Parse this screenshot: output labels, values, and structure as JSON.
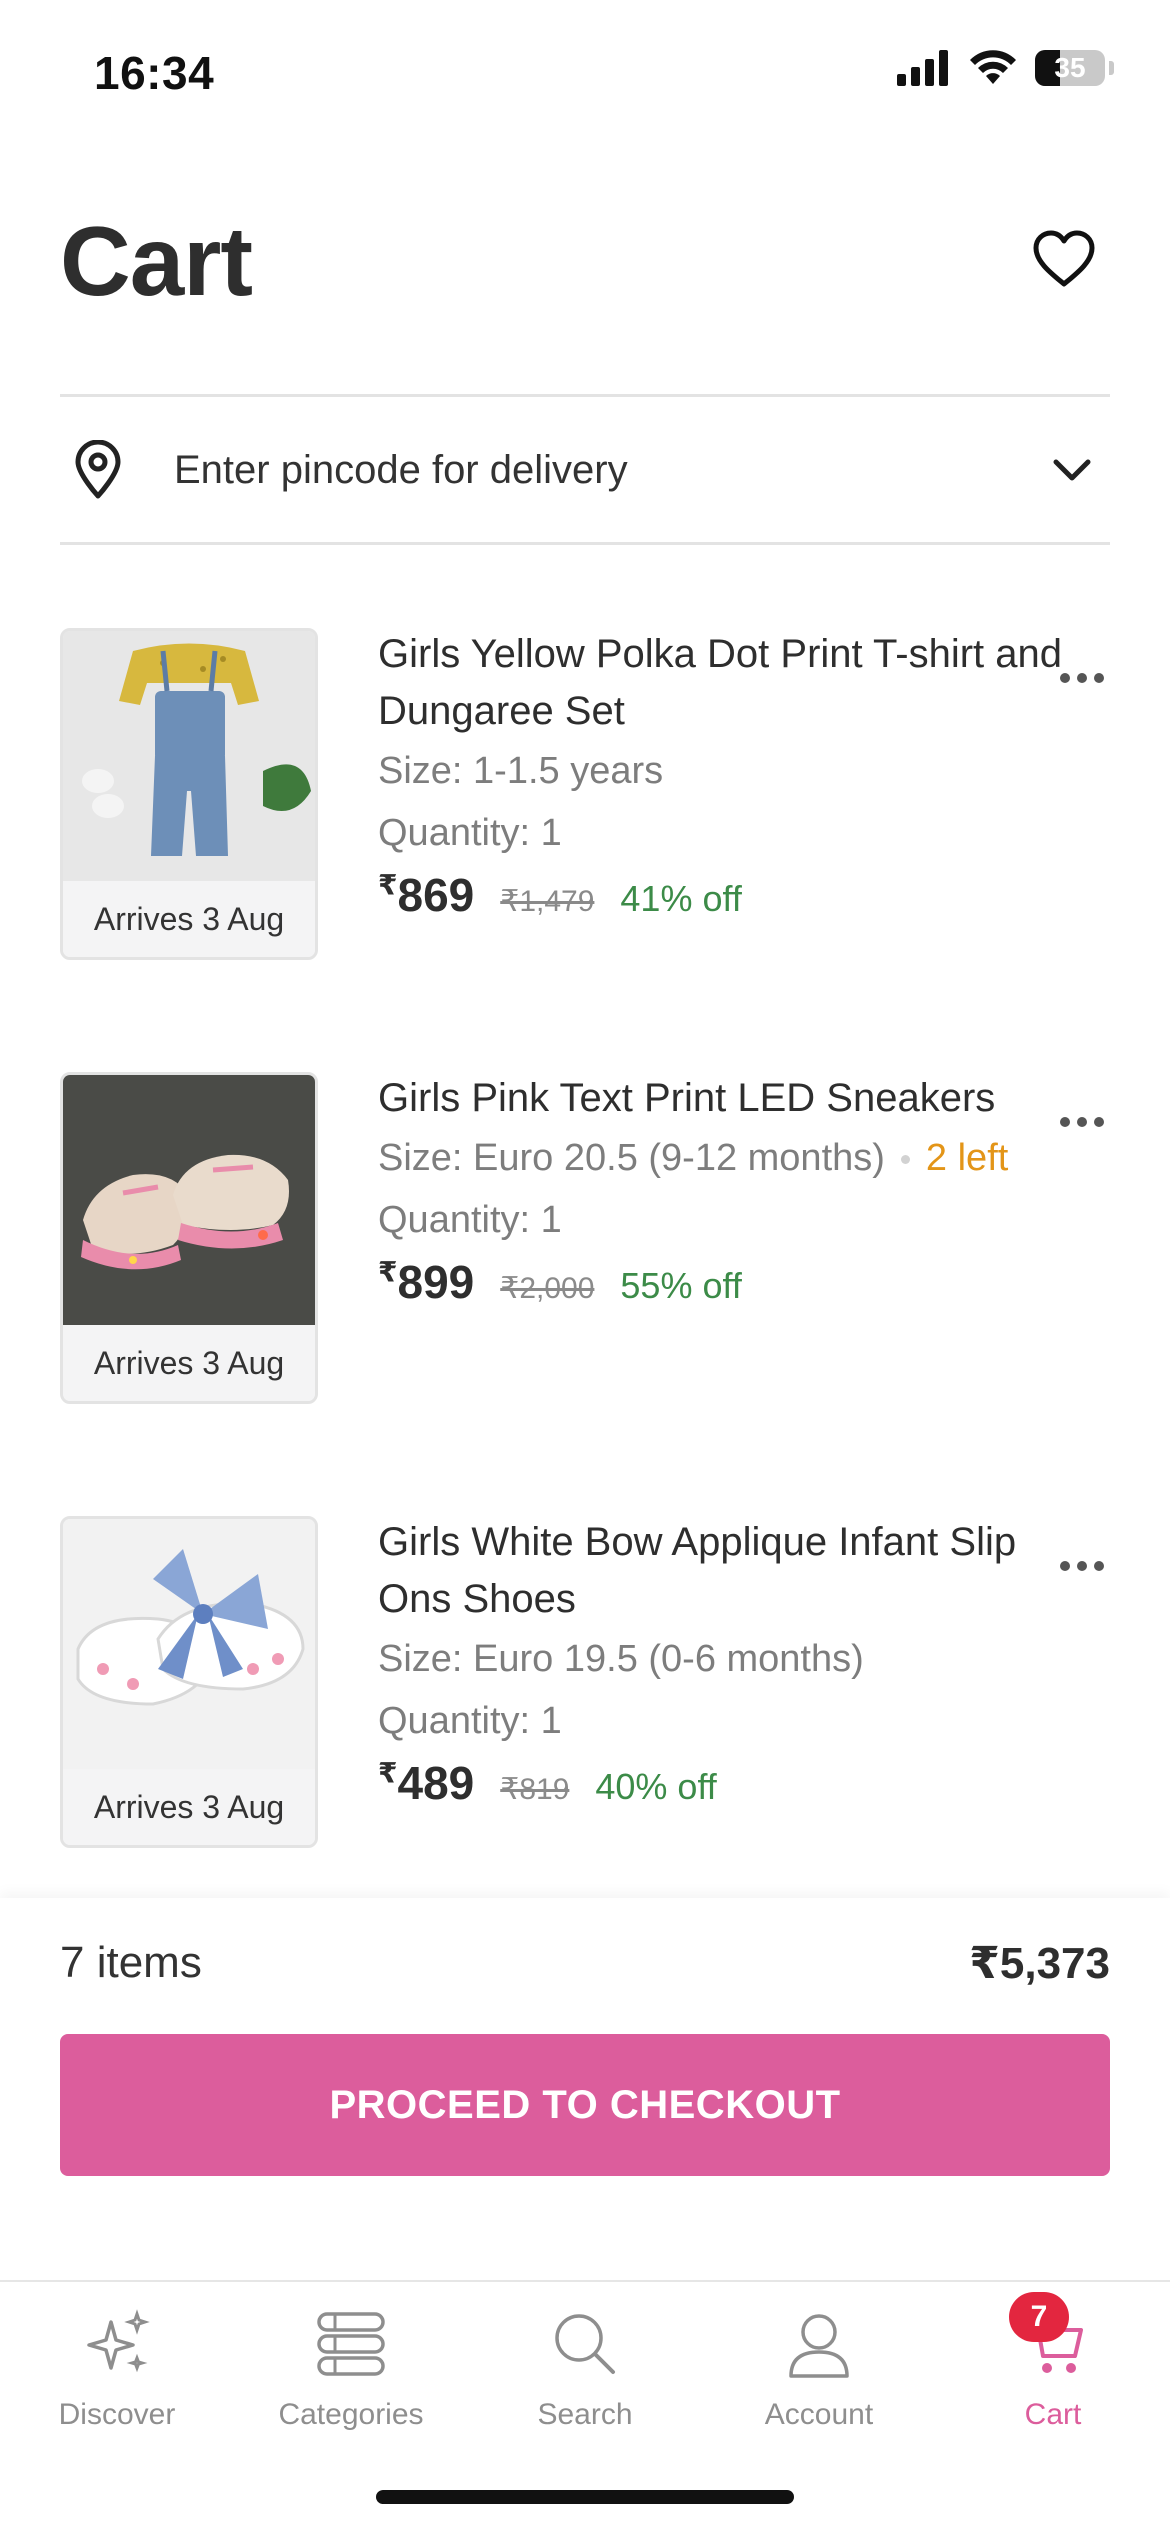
{
  "status_bar": {
    "time": "16:34",
    "battery_level": "35"
  },
  "header": {
    "title": "Cart"
  },
  "pincode": {
    "label": "Enter pincode for delivery"
  },
  "items": [
    {
      "name": "Girls Yellow Polka Dot Print T-shirt and Dungaree Set",
      "size": "Size: 1-1.5 years",
      "stock_note": "",
      "quantity": "Quantity: 1",
      "currency": "₹",
      "price": "869",
      "mrp": "₹1,479",
      "discount": "41% off",
      "arrival": "Arrives 3 Aug"
    },
    {
      "name": "Girls Pink Text Print LED Sneakers",
      "size": "Size: Euro 20.5 (9-12 months)",
      "stock_note": "2 left",
      "quantity": "Quantity: 1",
      "currency": "₹",
      "price": "899",
      "mrp": "₹2,000",
      "discount": "55% off",
      "arrival": "Arrives 3 Aug"
    },
    {
      "name": "Girls White Bow Applique Infant Slip Ons Shoes",
      "size": "Size: Euro 19.5 (0-6 months)",
      "stock_note": "",
      "quantity": "Quantity: 1",
      "currency": "₹",
      "price": "489",
      "mrp": "₹819",
      "discount": "40% off",
      "arrival": "Arrives 3 Aug"
    }
  ],
  "summary": {
    "items_count": "7 items",
    "total": "₹5,373"
  },
  "checkout": {
    "label": "PROCEED TO CHECKOUT"
  },
  "tabs": [
    {
      "label": "Discover",
      "icon": "sparkle-icon"
    },
    {
      "label": "Categories",
      "icon": "categories-icon"
    },
    {
      "label": "Search",
      "icon": "search-icon"
    },
    {
      "label": "Account",
      "icon": "account-icon"
    },
    {
      "label": "Cart",
      "icon": "cart-icon",
      "badge": "7"
    }
  ],
  "colors": {
    "accent": "#dc5d9c",
    "discount": "#3c8b48",
    "stock_warning": "#e39518",
    "badge": "#e3263f"
  }
}
